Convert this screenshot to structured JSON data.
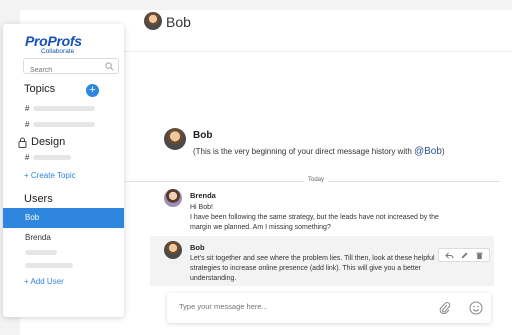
{
  "brand": {
    "name": "ProProfs",
    "sub": "Collaborate"
  },
  "header": {
    "title": "Bob"
  },
  "search": {
    "placeholder": "Search"
  },
  "sidebar": {
    "topics_title": "Topics",
    "topic_hash": "#",
    "design_title": "Design",
    "create_topic": "+ Create Topic",
    "users_title": "Users",
    "users": [
      "Bob",
      "Brenda"
    ],
    "add_user": "+ Add User"
  },
  "intro": {
    "name": "Bob",
    "text": "(This is the very beginning of your direct message history with ",
    "mention": "@Bob",
    "close": ")"
  },
  "divider": {
    "label": "Today"
  },
  "messages": [
    {
      "author": "Brenda",
      "lines": [
        "Hi Bob!",
        "I have been following the same strategy, but the leads have not increased by the",
        "margin we planned. Am I missing something?"
      ]
    },
    {
      "author": "Bob",
      "lines": [
        "Let's sit together and see where the problem lies. Till then, look at these helpful",
        "strategies to increase online presence (add link). This will give you a better",
        "understanding."
      ]
    }
  ],
  "composer": {
    "placeholder": "Type your message here..."
  },
  "icons": {
    "accent": "#2e86de",
    "brand": "#1552b8"
  }
}
